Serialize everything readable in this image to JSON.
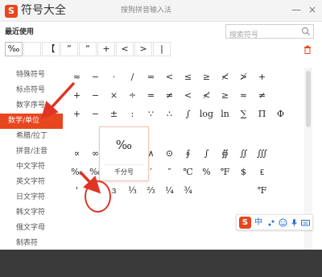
{
  "titlebar": {
    "logo": "S",
    "title": "符号大全",
    "window_title": "搜狗拼音输入法",
    "minimize": "—",
    "close": "×"
  },
  "recent": {
    "label": "最近使用",
    "symbols": [
      "‰",
      "",
      "【",
      "”",
      "“",
      "+",
      "<",
      ">",
      "|"
    ]
  },
  "search": {
    "placeholder": "搜索符号"
  },
  "sidebar": {
    "items": [
      {
        "label": "特殊符号",
        "active": false
      },
      {
        "label": "标点符号",
        "active": false
      },
      {
        "label": "数字序号",
        "active": false
      },
      {
        "label": "数学/单位",
        "active": true
      },
      {
        "label": "希腊/拉丁",
        "active": false
      },
      {
        "label": "拼音/注音",
        "active": false
      },
      {
        "label": "中文字符",
        "active": false
      },
      {
        "label": "英文字符",
        "active": false
      },
      {
        "label": "日文字符",
        "active": false
      },
      {
        "label": "韩文字符",
        "active": false
      },
      {
        "label": "俄文字母",
        "active": false
      },
      {
        "label": "制表符",
        "active": false
      }
    ]
  },
  "symbol_grid_top": [
    [
      "≈",
      "−",
      "·",
      "/",
      "=",
      "<",
      "≤",
      "≥",
      "≮",
      "≯",
      "+"
    ],
    [
      "+",
      "−",
      "×",
      "÷",
      "=",
      "≠",
      "<",
      "≮",
      "≥",
      "≈",
      "≠"
    ],
    [
      "+",
      "−",
      "±",
      ":",
      "∵",
      "∴",
      "∫",
      "log",
      "ln",
      "∑",
      "Π",
      "Φ"
    ]
  ],
  "symbol_grid_bottom": [
    [
      "∝",
      "∞",
      "",
      "",
      "∧",
      "⊙",
      "∮",
      "∫",
      "∯",
      "∬",
      "∭"
    ],
    [
      "‰",
      "‰",
      "%",
      "°",
      "′",
      "″",
      "℃",
      "%",
      "℉",
      "$",
      "₤"
    ],
    [
      "'",
      "ˇ",
      "ɜ",
      "⅓",
      "⅔",
      "¼",
      "¾",
      "",
      "",
      "",
      "℉"
    ]
  ],
  "tooltip": {
    "symbol": "‰",
    "label": "千分号"
  },
  "ime": {
    "logo": "S",
    "lang": "中"
  },
  "colors": {
    "accent": "#e8461e",
    "annotation": "#e03524"
  }
}
